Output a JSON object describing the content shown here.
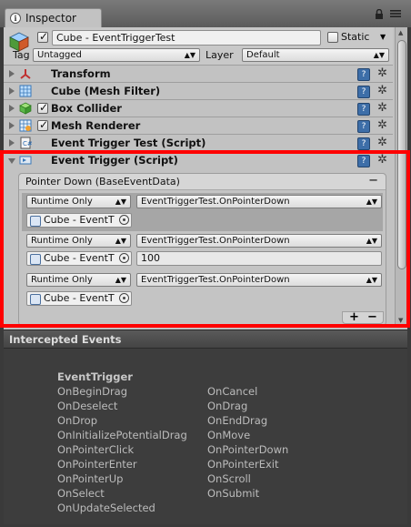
{
  "window": {
    "tab_label": "Inspector"
  },
  "header": {
    "object_name": "Cube - EventTriggerTest",
    "static_label": "Static",
    "tag_label": "Tag",
    "tag_value": "Untagged",
    "layer_label": "Layer",
    "layer_value": "Default"
  },
  "components": [
    {
      "title": "Transform"
    },
    {
      "title": "Cube (Mesh Filter)"
    },
    {
      "title": "Box Collider"
    },
    {
      "title": "Mesh Renderer"
    },
    {
      "title": "Event Trigger Test (Script)"
    },
    {
      "title": "Event Trigger (Script)"
    }
  ],
  "event_trigger": {
    "group_title": "Pointer Down (BaseEventData)",
    "remove_symbol": "−",
    "add_symbol": "+",
    "entries": [
      {
        "mode": "Runtime Only",
        "function": "EventTriggerTest.OnPointerDown",
        "object": "Cube - EventT",
        "argument": ""
      },
      {
        "mode": "Runtime Only",
        "function": "EventTriggerTest.OnPointerDown",
        "object": "Cube - EventT",
        "argument": "100"
      },
      {
        "mode": "Runtime Only",
        "function": "EventTriggerTest.OnPointerDown",
        "object": "Cube - EventT",
        "argument": ""
      }
    ]
  },
  "intercepted": {
    "title": "Intercepted Events",
    "class_name": "EventTrigger",
    "left_column": [
      "OnBeginDrag",
      "OnDeselect",
      "OnDrop",
      "OnInitializePotentialDrag",
      "OnPointerClick",
      "OnPointerEnter",
      "OnPointerUp",
      "OnSelect",
      "OnUpdateSelected"
    ],
    "right_column": [
      "OnCancel",
      "OnDrag",
      "OnEndDrag",
      "OnMove",
      "OnPointerDown",
      "OnPointerExit",
      "OnScroll",
      "OnSubmit"
    ]
  },
  "icons": {
    "menu": "menu-icon",
    "lock": "lock-icon",
    "help": "help-icon",
    "gear": "gear-icon"
  }
}
